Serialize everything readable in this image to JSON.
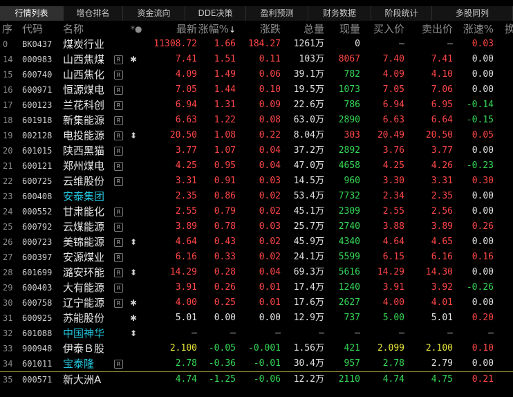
{
  "tabs": [
    {
      "label": "行情列表",
      "active": true
    },
    {
      "label": "增仓排名",
      "active": false
    },
    {
      "label": "资金流向",
      "active": false
    },
    {
      "label": "DDE决策",
      "active": false
    },
    {
      "label": "盈利预测",
      "active": false
    },
    {
      "label": "财务数据",
      "active": false
    },
    {
      "label": "阶段统计",
      "active": false
    },
    {
      "label": "多股同列",
      "active": false
    }
  ],
  "header": {
    "idx": "序",
    "code": "代码",
    "name": "名称",
    "flags": "*●",
    "price": "最新",
    "pct": "涨幅%",
    "sort_arrow": "↓",
    "chg": "涨跌",
    "vol": "总量",
    "cur": "现量",
    "bid": "买入价",
    "ask": "卖出价",
    "speed": "涨速%",
    "extra": "换"
  },
  "colors": {
    "up": "#ff4646",
    "down": "#35d855",
    "flat": "#e2e2e2",
    "highlight": "#22c8e0",
    "divider": "#a8a83a"
  },
  "icons": {
    "r_badge": "R",
    "star": "✱",
    "updown": "⬍"
  },
  "rows": [
    {
      "idx": "0",
      "code": "BK0437",
      "name": "煤炭行业",
      "r": false,
      "mark": "",
      "price": "11308.72",
      "pct": "1.66",
      "chg": "184.27",
      "vol": "1261万",
      "cur": "0",
      "bid": "—",
      "ask": "—",
      "speed": "0.03",
      "pc": "r",
      "cc": "r",
      "vc": "w",
      "curc": "w",
      "bc": "w",
      "ac": "w",
      "sc": "r",
      "hl": false
    },
    {
      "idx": "14",
      "code": "000983",
      "name": "山西焦煤",
      "r": true,
      "mark": "star",
      "price": "7.41",
      "pct": "1.51",
      "chg": "0.11",
      "vol": "103万",
      "cur": "8067",
      "bid": "7.40",
      "ask": "7.41",
      "speed": "0.00",
      "pc": "r",
      "cc": "r",
      "vc": "w",
      "curc": "r",
      "bc": "r",
      "ac": "r",
      "sc": "w",
      "hl": false
    },
    {
      "idx": "15",
      "code": "600740",
      "name": "山西焦化",
      "r": true,
      "mark": "",
      "price": "4.09",
      "pct": "1.49",
      "chg": "0.06",
      "vol": "39.1万",
      "cur": "782",
      "bid": "4.09",
      "ask": "4.10",
      "speed": "0.00",
      "pc": "r",
      "cc": "r",
      "vc": "w",
      "curc": "g",
      "bc": "r",
      "ac": "r",
      "sc": "w",
      "hl": false
    },
    {
      "idx": "16",
      "code": "600971",
      "name": "恒源煤电",
      "r": true,
      "mark": "",
      "price": "7.05",
      "pct": "1.44",
      "chg": "0.10",
      "vol": "19.5万",
      "cur": "1073",
      "bid": "7.05",
      "ask": "7.06",
      "speed": "0.00",
      "pc": "r",
      "cc": "r",
      "vc": "w",
      "curc": "g",
      "bc": "r",
      "ac": "r",
      "sc": "w",
      "hl": false
    },
    {
      "idx": "17",
      "code": "600123",
      "name": "兰花科创",
      "r": true,
      "mark": "",
      "price": "6.94",
      "pct": "1.31",
      "chg": "0.09",
      "vol": "22.6万",
      "cur": "786",
      "bid": "6.94",
      "ask": "6.95",
      "speed": "-0.14",
      "pc": "r",
      "cc": "r",
      "vc": "w",
      "curc": "g",
      "bc": "r",
      "ac": "r",
      "sc": "g",
      "hl": false
    },
    {
      "idx": "18",
      "code": "601918",
      "name": "新集能源",
      "r": true,
      "mark": "",
      "price": "6.63",
      "pct": "1.22",
      "chg": "0.08",
      "vol": "63.0万",
      "cur": "2890",
      "bid": "6.63",
      "ask": "6.64",
      "speed": "-0.15",
      "pc": "r",
      "cc": "r",
      "vc": "w",
      "curc": "g",
      "bc": "r",
      "ac": "r",
      "sc": "g",
      "hl": false
    },
    {
      "idx": "19",
      "code": "002128",
      "name": "电投能源",
      "r": true,
      "mark": "updown",
      "price": "20.50",
      "pct": "1.08",
      "chg": "0.22",
      "vol": "8.04万",
      "cur": "303",
      "bid": "20.49",
      "ask": "20.50",
      "speed": "0.05",
      "pc": "r",
      "cc": "r",
      "vc": "w",
      "curc": "r",
      "bc": "r",
      "ac": "r",
      "sc": "r",
      "hl": false
    },
    {
      "idx": "20",
      "code": "601015",
      "name": "陕西黑猫",
      "r": true,
      "mark": "",
      "price": "3.77",
      "pct": "1.07",
      "chg": "0.04",
      "vol": "37.2万",
      "cur": "2892",
      "bid": "3.76",
      "ask": "3.77",
      "speed": "0.00",
      "pc": "r",
      "cc": "r",
      "vc": "w",
      "curc": "g",
      "bc": "r",
      "ac": "r",
      "sc": "w",
      "hl": false
    },
    {
      "idx": "21",
      "code": "600121",
      "name": "郑州煤电",
      "r": true,
      "mark": "",
      "price": "4.25",
      "pct": "0.95",
      "chg": "0.04",
      "vol": "47.0万",
      "cur": "4658",
      "bid": "4.25",
      "ask": "4.26",
      "speed": "-0.23",
      "pc": "r",
      "cc": "r",
      "vc": "w",
      "curc": "g",
      "bc": "r",
      "ac": "r",
      "sc": "g",
      "hl": false
    },
    {
      "idx": "22",
      "code": "600725",
      "name": "云维股份",
      "r": true,
      "mark": "",
      "price": "3.31",
      "pct": "0.91",
      "chg": "0.03",
      "vol": "14.5万",
      "cur": "960",
      "bid": "3.30",
      "ask": "3.31",
      "speed": "0.30",
      "pc": "r",
      "cc": "r",
      "vc": "w",
      "curc": "g",
      "bc": "r",
      "ac": "r",
      "sc": "r",
      "hl": false
    },
    {
      "idx": "23",
      "code": "600408",
      "name": "安泰集团",
      "r": false,
      "mark": "",
      "price": "2.35",
      "pct": "0.86",
      "chg": "0.02",
      "vol": "53.4万",
      "cur": "7732",
      "bid": "2.34",
      "ask": "2.35",
      "speed": "0.00",
      "pc": "r",
      "cc": "r",
      "vc": "w",
      "curc": "g",
      "bc": "r",
      "ac": "r",
      "sc": "w",
      "hl": true
    },
    {
      "idx": "24",
      "code": "000552",
      "name": "甘肃能化",
      "r": true,
      "mark": "",
      "price": "2.55",
      "pct": "0.79",
      "chg": "0.02",
      "vol": "45.1万",
      "cur": "2309",
      "bid": "2.55",
      "ask": "2.56",
      "speed": "0.00",
      "pc": "r",
      "cc": "r",
      "vc": "w",
      "curc": "g",
      "bc": "r",
      "ac": "r",
      "sc": "w",
      "hl": false
    },
    {
      "idx": "25",
      "code": "600792",
      "name": "云煤能源",
      "r": true,
      "mark": "",
      "price": "3.89",
      "pct": "0.78",
      "chg": "0.03",
      "vol": "25.7万",
      "cur": "2740",
      "bid": "3.88",
      "ask": "3.89",
      "speed": "0.26",
      "pc": "r",
      "cc": "r",
      "vc": "w",
      "curc": "g",
      "bc": "r",
      "ac": "r",
      "sc": "r",
      "hl": false
    },
    {
      "idx": "26",
      "code": "000723",
      "name": "美锦能源",
      "r": true,
      "mark": "updown",
      "price": "4.64",
      "pct": "0.43",
      "chg": "0.02",
      "vol": "45.9万",
      "cur": "4340",
      "bid": "4.64",
      "ask": "4.65",
      "speed": "0.00",
      "pc": "r",
      "cc": "r",
      "vc": "w",
      "curc": "g",
      "bc": "r",
      "ac": "r",
      "sc": "w",
      "hl": false
    },
    {
      "idx": "27",
      "code": "600397",
      "name": "安源煤业",
      "r": true,
      "mark": "",
      "price": "6.16",
      "pct": "0.33",
      "chg": "0.02",
      "vol": "24.1万",
      "cur": "5599",
      "bid": "6.15",
      "ask": "6.16",
      "speed": "0.16",
      "pc": "r",
      "cc": "r",
      "vc": "w",
      "curc": "g",
      "bc": "r",
      "ac": "r",
      "sc": "r",
      "hl": false
    },
    {
      "idx": "28",
      "code": "601699",
      "name": "潞安环能",
      "r": true,
      "mark": "updown",
      "price": "14.29",
      "pct": "0.28",
      "chg": "0.04",
      "vol": "69.3万",
      "cur": "5616",
      "bid": "14.29",
      "ask": "14.30",
      "speed": "0.00",
      "pc": "r",
      "cc": "r",
      "vc": "w",
      "curc": "g",
      "bc": "r",
      "ac": "r",
      "sc": "w",
      "hl": false
    },
    {
      "idx": "29",
      "code": "600403",
      "name": "大有能源",
      "r": true,
      "mark": "",
      "price": "3.91",
      "pct": "0.26",
      "chg": "0.01",
      "vol": "17.4万",
      "cur": "1240",
      "bid": "3.91",
      "ask": "3.92",
      "speed": "-0.26",
      "pc": "r",
      "cc": "r",
      "vc": "w",
      "curc": "g",
      "bc": "r",
      "ac": "r",
      "sc": "g",
      "hl": false
    },
    {
      "idx": "30",
      "code": "600758",
      "name": "辽宁能源",
      "r": true,
      "mark": "star",
      "price": "4.00",
      "pct": "0.25",
      "chg": "0.01",
      "vol": "17.6万",
      "cur": "2627",
      "bid": "4.00",
      "ask": "4.01",
      "speed": "0.00",
      "pc": "r",
      "cc": "r",
      "vc": "w",
      "curc": "g",
      "bc": "r",
      "ac": "r",
      "sc": "w",
      "hl": false
    },
    {
      "idx": "31",
      "code": "600925",
      "name": "苏能股份",
      "r": false,
      "mark": "star",
      "price": "5.01",
      "pct": "0.00",
      "chg": "0.00",
      "vol": "12.9万",
      "cur": "737",
      "bid": "5.00",
      "ask": "5.01",
      "speed": "0.20",
      "pc": "w",
      "cc": "w",
      "vc": "w",
      "curc": "g",
      "bc": "g",
      "ac": "w",
      "sc": "r",
      "hl": false
    },
    {
      "idx": "32",
      "code": "601088",
      "name": "中国神华",
      "r": false,
      "mark": "updown",
      "price": "—",
      "pct": "—",
      "chg": "—",
      "vol": "—",
      "cur": "—",
      "bid": "—",
      "ask": "—",
      "speed": "—",
      "pc": "w",
      "cc": "w",
      "vc": "w",
      "curc": "w",
      "bc": "w",
      "ac": "w",
      "sc": "w",
      "hl": true
    },
    {
      "idx": "33",
      "code": "900948",
      "name": "伊泰Ｂ股",
      "r": false,
      "mark": "",
      "price": "2.100",
      "pct": "-0.05",
      "chg": "-0.001",
      "vol": "1.56万",
      "cur": "421",
      "bid": "2.099",
      "ask": "2.100",
      "speed": "0.10",
      "pc": "y",
      "cc": "g",
      "vc": "w",
      "curc": "g",
      "bc": "y",
      "ac": "y",
      "sc": "r",
      "hl": false
    },
    {
      "idx": "34",
      "code": "601011",
      "name": "宝泰隆",
      "r": true,
      "mark": "",
      "price": "2.78",
      "pct": "-0.36",
      "chg": "-0.01",
      "vol": "30.4万",
      "cur": "957",
      "bid": "2.78",
      "ask": "2.79",
      "speed": "0.00",
      "pc": "g",
      "cc": "g",
      "vc": "w",
      "curc": "g",
      "bc": "g",
      "ac": "w",
      "sc": "w",
      "hl": true
    },
    {
      "idx": "35",
      "code": "000571",
      "name": "新大洲A",
      "r": false,
      "mark": "",
      "price": "4.74",
      "pct": "-1.25",
      "chg": "-0.06",
      "vol": "12.2万",
      "cur": "2110",
      "bid": "4.74",
      "ask": "4.75",
      "speed": "0.21",
      "pc": "g",
      "cc": "g",
      "vc": "w",
      "curc": "g",
      "bc": "g",
      "ac": "g",
      "sc": "r",
      "hl": false
    }
  ]
}
